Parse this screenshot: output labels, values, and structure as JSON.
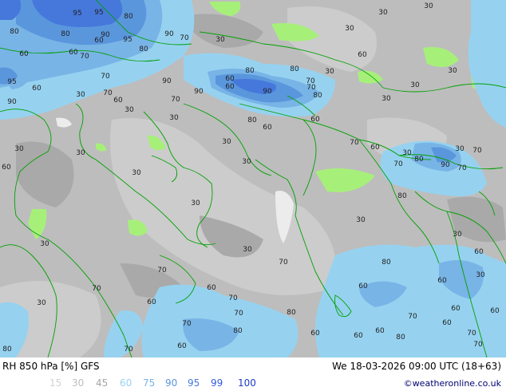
{
  "map": {
    "contour_labels": [
      {
        "text": "95"
      },
      {
        "text": "95"
      },
      {
        "text": "80"
      },
      {
        "text": "30"
      },
      {
        "text": "30"
      },
      {
        "text": "80"
      },
      {
        "text": "80"
      },
      {
        "text": "60"
      },
      {
        "text": "90"
      },
      {
        "text": "95"
      },
      {
        "text": "90"
      },
      {
        "text": "70"
      },
      {
        "text": "30"
      },
      {
        "text": "30"
      },
      {
        "text": "60"
      },
      {
        "text": "60"
      },
      {
        "text": "70"
      },
      {
        "text": "80"
      },
      {
        "text": "70"
      },
      {
        "text": "95"
      },
      {
        "text": "60"
      },
      {
        "text": "70"
      },
      {
        "text": "90"
      },
      {
        "text": "60"
      },
      {
        "text": "90"
      },
      {
        "text": "80"
      },
      {
        "text": "30"
      },
      {
        "text": "80"
      },
      {
        "text": "30"
      },
      {
        "text": "60"
      },
      {
        "text": "70"
      },
      {
        "text": "70"
      },
      {
        "text": "90"
      },
      {
        "text": "30"
      },
      {
        "text": "80"
      },
      {
        "text": "60"
      },
      {
        "text": "90"
      },
      {
        "text": "70"
      },
      {
        "text": "30"
      },
      {
        "text": "60"
      },
      {
        "text": "30"
      },
      {
        "text": "80"
      },
      {
        "text": "60"
      },
      {
        "text": "30"
      },
      {
        "text": "30"
      },
      {
        "text": "70"
      },
      {
        "text": "60"
      },
      {
        "text": "30"
      },
      {
        "text": "30"
      },
      {
        "text": "70"
      },
      {
        "text": "60"
      },
      {
        "text": "30"
      },
      {
        "text": "30"
      },
      {
        "text": "80"
      },
      {
        "text": "90"
      },
      {
        "text": "70"
      },
      {
        "text": "30"
      },
      {
        "text": "30"
      },
      {
        "text": "70"
      },
      {
        "text": "60"
      },
      {
        "text": "80"
      },
      {
        "text": "30"
      },
      {
        "text": "30"
      },
      {
        "text": "30"
      },
      {
        "text": "30"
      },
      {
        "text": "30"
      },
      {
        "text": "30"
      },
      {
        "text": "80"
      },
      {
        "text": "60"
      },
      {
        "text": "70"
      },
      {
        "text": "70"
      },
      {
        "text": "70"
      },
      {
        "text": "60"
      },
      {
        "text": "30"
      },
      {
        "text": "60"
      },
      {
        "text": "60"
      },
      {
        "text": "70"
      },
      {
        "text": "30"
      },
      {
        "text": "60"
      },
      {
        "text": "70"
      },
      {
        "text": "60"
      },
      {
        "text": "80"
      },
      {
        "text": "70"
      },
      {
        "text": "70"
      },
      {
        "text": "60"
      },
      {
        "text": "60"
      },
      {
        "text": "80"
      },
      {
        "text": "60"
      },
      {
        "text": "70"
      },
      {
        "text": "60"
      },
      {
        "text": "70"
      },
      {
        "text": "80"
      },
      {
        "text": "70"
      },
      {
        "text": "60"
      },
      {
        "text": "80"
      },
      {
        "text": "60"
      }
    ]
  },
  "footer": {
    "title": "RH 850 hPa [%] GFS",
    "datetime": "We 18-03-2026 09:00 UTC (18+63)",
    "credit": "©weatheronline.co.uk"
  },
  "legend": {
    "items": [
      {
        "label": "15",
        "color": "#d2d2d2"
      },
      {
        "label": "30",
        "color": "#bebebe"
      },
      {
        "label": "45",
        "color": "#a5a5a5"
      },
      {
        "label": "60",
        "color": "#96d2f0"
      },
      {
        "label": "75",
        "color": "#78b4e6"
      },
      {
        "label": "90",
        "color": "#5a96dc"
      },
      {
        "label": "95",
        "color": "#4678dc"
      },
      {
        "label": "99",
        "color": "#325adc"
      },
      {
        "label": "100",
        "color": "#1e3cc8"
      }
    ]
  },
  "colors": {
    "background": "#bdbdbd",
    "border": "#00a000",
    "moist_green": "#a6f07a",
    "dry_light": "#dcdcdc",
    "dry_white": "#f0f0f0"
  }
}
